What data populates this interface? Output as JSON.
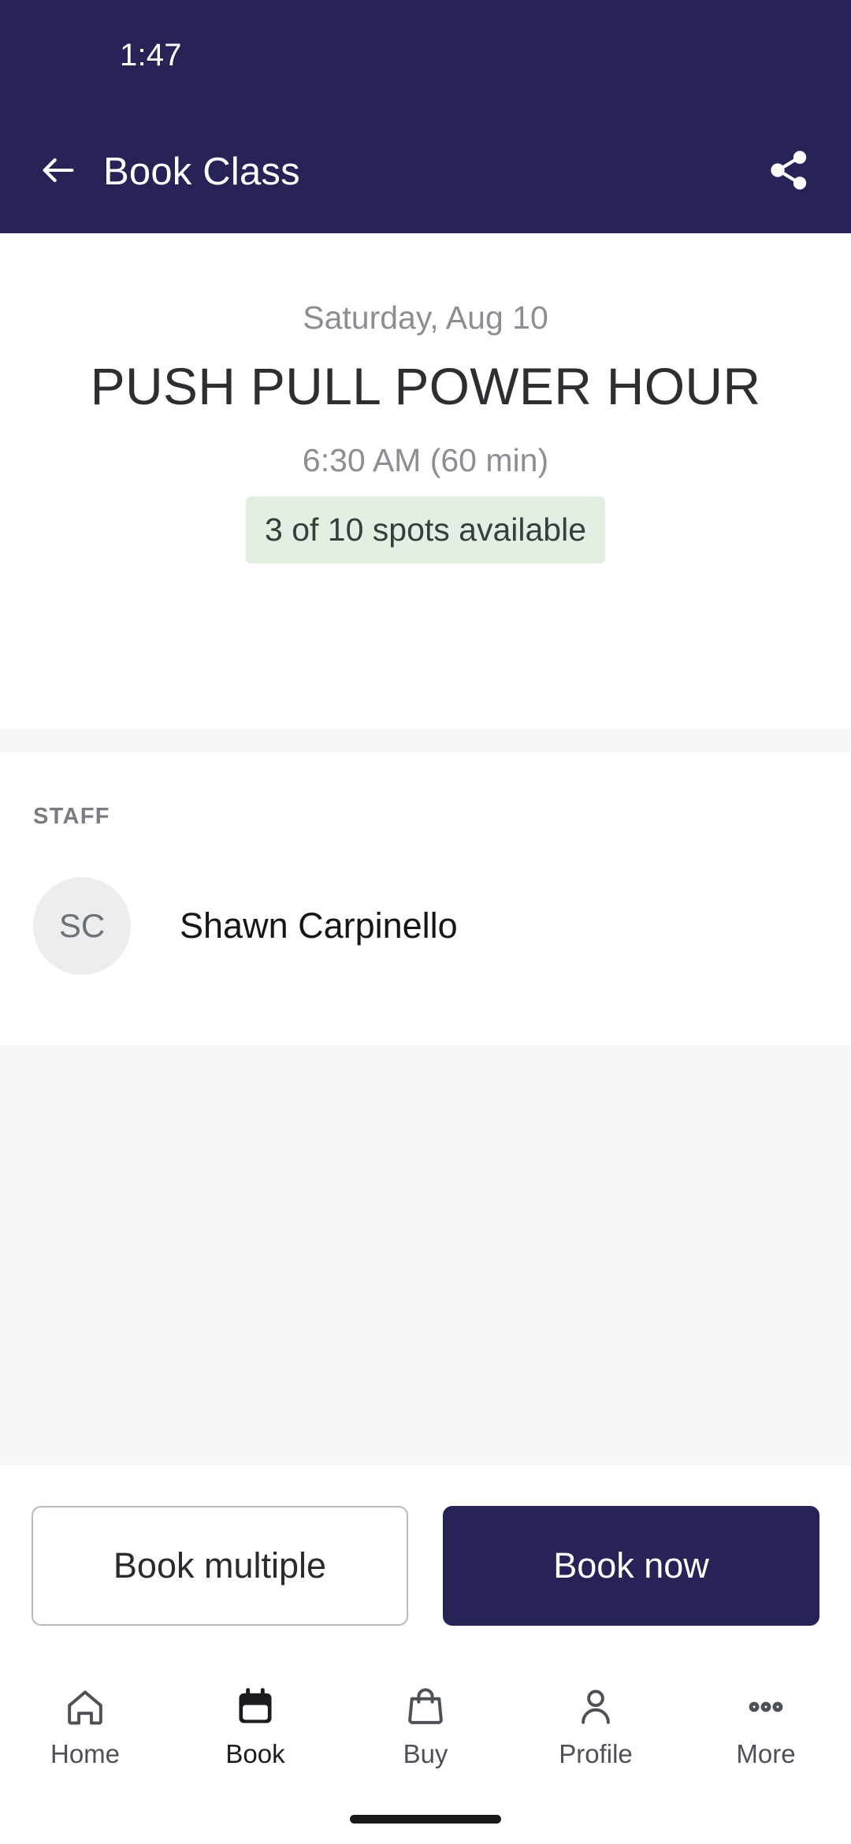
{
  "status_bar": {
    "time": "1:47"
  },
  "app_bar": {
    "title": "Book Class",
    "back_icon": "arrow-left-icon",
    "share_icon": "share-icon"
  },
  "class": {
    "date": "Saturday, Aug 10",
    "name": "PUSH PULL POWER HOUR",
    "time": "6:30 AM (60 min)",
    "availability": "3 of 10 spots available"
  },
  "staff": {
    "section_label": "STAFF",
    "members": [
      {
        "initials": "SC",
        "name": "Shawn Carpinello"
      }
    ]
  },
  "actions": {
    "secondary_label": "Book multiple",
    "primary_label": "Book now"
  },
  "bottom_nav": {
    "items": [
      {
        "label": "Home",
        "icon": "home-icon",
        "active": false
      },
      {
        "label": "Book",
        "icon": "calendar-icon",
        "active": true
      },
      {
        "label": "Buy",
        "icon": "bag-icon",
        "active": false
      },
      {
        "label": "Profile",
        "icon": "person-icon",
        "active": false
      },
      {
        "label": "More",
        "icon": "ellipsis-icon",
        "active": false
      }
    ]
  },
  "colors": {
    "brand_navy": "#262456",
    "badge_green_bg": "#e3efe2",
    "badge_green_text": "#33413a",
    "page_bg": "#f7f8fa"
  }
}
